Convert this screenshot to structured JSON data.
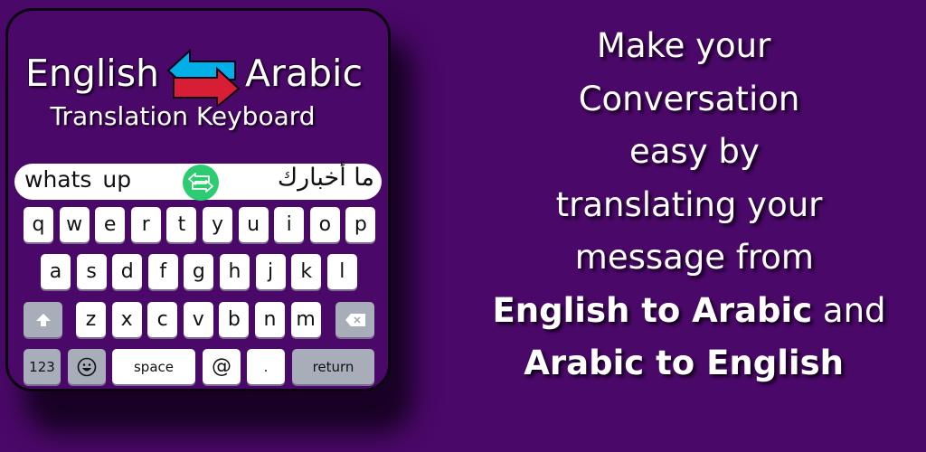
{
  "colors": {
    "background": "#4a0868",
    "arrow_blue": "#00aee8",
    "arrow_red": "#d81e35",
    "swap_green": "#2ecc71",
    "key_white": "#ffffff",
    "key_gray": "#a8adba"
  },
  "header": {
    "title_left": "English",
    "title_right": "Arabic",
    "subtitle": "Translation Keyboard",
    "arrows_icon": "swap-arrows-icon"
  },
  "translate_bar": {
    "source_text": "whats up",
    "target_text": "ما أخبارك",
    "swap_icon": "swap-icon"
  },
  "keyboard": {
    "row1": [
      "q",
      "w",
      "e",
      "r",
      "t",
      "y",
      "u",
      "i",
      "o",
      "p"
    ],
    "row2": [
      "a",
      "s",
      "d",
      "f",
      "g",
      "h",
      "j",
      "k",
      "l"
    ],
    "row3": [
      "z",
      "x",
      "c",
      "v",
      "b",
      "n",
      "m"
    ],
    "shift_icon": "shift-icon",
    "delete_icon": "backspace-icon",
    "numbers_label": "123",
    "emoji_icon": "emoji-icon",
    "space_label": "space",
    "at_label": "@",
    "period_label": ".",
    "return_label": "return"
  },
  "tagline": {
    "lines": [
      "Make your ",
      "Conversation",
      " easy by",
      "translating your",
      " message from",
      "English to Arabic and",
      "Arabic to English "
    ],
    "bold_lines_note": "lines 6-7 partially bold",
    "line6_bold": "English to Arabic",
    "line6_rest": " and",
    "line7_bold": "Arabic to English",
    "line7_rest": " "
  }
}
